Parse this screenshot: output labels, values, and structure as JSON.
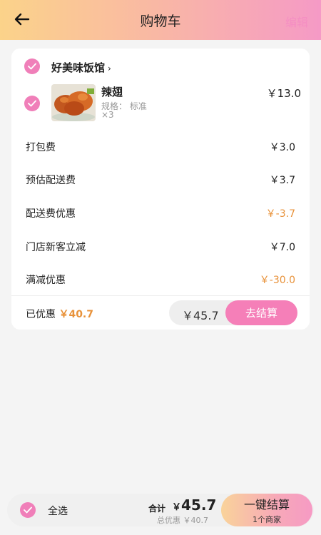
{
  "header": {
    "title": "购物车",
    "edit_label": "编辑"
  },
  "shop": {
    "name": "好美味饭馆",
    "arrow": "›"
  },
  "item": {
    "name": "辣翅",
    "spec": "规格： 标准",
    "qty": "×3",
    "price": "￥13.0"
  },
  "fees": [
    {
      "label": "打包费",
      "value": "￥3.0",
      "discount": false
    },
    {
      "label": "预估配送费",
      "value": "￥3.7",
      "discount": false
    },
    {
      "label": "配送费优惠",
      "value": "￥-3.7",
      "discount": true
    },
    {
      "label": "门店新客立减",
      "value": "￥7.0",
      "discount": false
    },
    {
      "label": "满减优惠",
      "value": "￥-30.0",
      "discount": true
    }
  ],
  "summary": {
    "saved_label": "已优惠",
    "saved_amount": "￥40.7",
    "total": "￥45.7",
    "checkout_label": "去结算"
  },
  "bottom": {
    "select_all": "全选",
    "sum_label": "合计",
    "sum_currency": "￥",
    "sum_value": "45.7",
    "discount_sub": "总优惠 ￥40.7",
    "one_click_label": "一键结算",
    "merchant_count": "1个商家"
  },
  "colors": {
    "accent": "#f07fb9",
    "discount": "#e8923a"
  },
  "icons": {
    "back": "arrow-left-icon",
    "check": "check-icon"
  }
}
